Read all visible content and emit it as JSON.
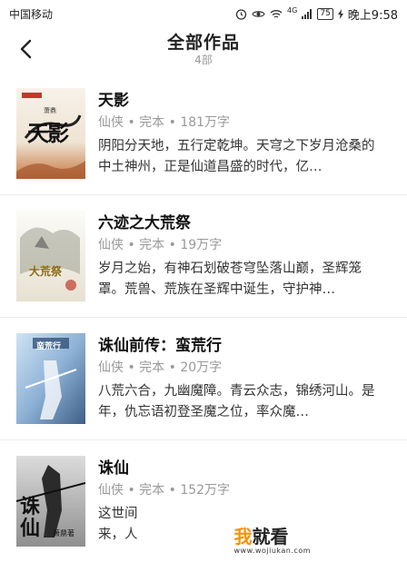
{
  "status_bar": {
    "carrier": "中国移动",
    "network": "4G",
    "battery": "75",
    "time": "晚上9:58"
  },
  "header": {
    "title": "全部作品",
    "subtitle": "4部"
  },
  "books": [
    {
      "title": "天影",
      "meta": "仙侠 • 完本 • 181万字",
      "description": "阴阳分天地，五行定乾坤。天穹之下岁月沧桑的中土神州，正是仙道昌盛的时代，亿…",
      "cover_text": "天影",
      "cover_author": "萧鼎"
    },
    {
      "title": "六迹之大荒祭",
      "meta": "仙侠 • 完本 • 19万字",
      "description": "岁月之始，有神石划破苍穹坠落山巅，圣辉笼罩。荒兽、荒族在圣辉中诞生，守护神…",
      "cover_text": "大荒祭"
    },
    {
      "title": "诛仙前传：蛮荒行",
      "meta": "仙侠 • 完本 • 20万字",
      "description": "八荒六合，九幽魔障。青云众志，锦绣河山。是年，仇忘语初登圣魔之位，率众魔…",
      "cover_text": "蛮荒行"
    },
    {
      "title": "诛仙",
      "meta": "仙侠 • 完本 • 152万字",
      "description": "这世间\n来，人",
      "cover_text": "诛仙",
      "cover_author": "萧鼎著"
    }
  ],
  "watermark": {
    "logo_accent": "我",
    "logo_rest": "就看",
    "url": "www.wojiukan.com"
  }
}
